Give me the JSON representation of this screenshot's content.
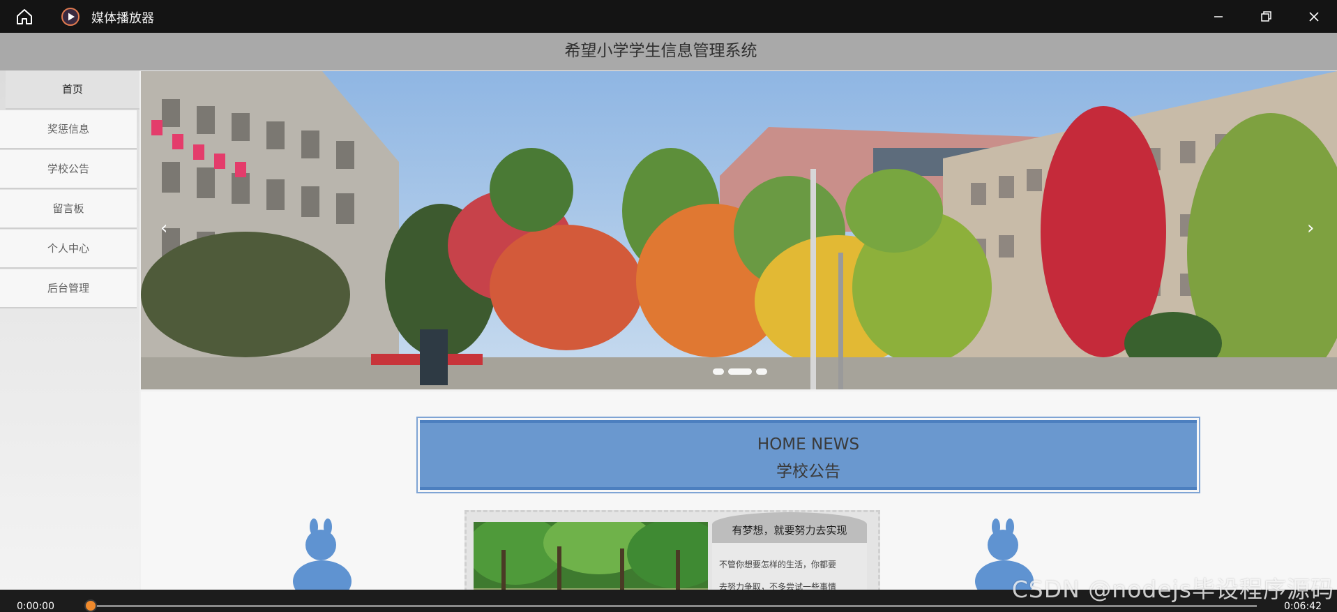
{
  "titlebar": {
    "app_title": "媒体播放器",
    "icons": {
      "home": "home-icon",
      "app": "media-player-play-icon",
      "minimize": "minimize-icon",
      "restore": "restore-icon",
      "close": "close-icon"
    }
  },
  "site": {
    "title": "希望小学学生信息管理系统"
  },
  "sidebar": {
    "items": [
      {
        "label": "首页",
        "active": true
      },
      {
        "label": "奖惩信息",
        "active": false
      },
      {
        "label": "学校公告",
        "active": false
      },
      {
        "label": "留言板",
        "active": false
      },
      {
        "label": "个人中心",
        "active": false
      },
      {
        "label": "后台管理",
        "active": false
      }
    ]
  },
  "carousel": {
    "prev_icon": "chevron-left-icon",
    "next_icon": "chevron-right-icon",
    "prev_glyph": "‹",
    "next_glyph": "›",
    "slide_count": 3,
    "active_index": 1
  },
  "news": {
    "heading_en": "HOME NEWS",
    "heading_cn": "学校公告",
    "card_title": "有梦想，就要努力去实现",
    "card_lines": [
      "不管你想要怎样的生活，你都要",
      "去努力争取，不多尝试一些事情"
    ]
  },
  "player": {
    "current_time": "0:00:00",
    "total_time": "0:06:42",
    "progress": 0.0
  },
  "watermark": "CSDN @nodejs毕设程序源码",
  "colors": {
    "banner_blue": "#6a98cf",
    "progress_thumb": "#f08a2c",
    "titlebar_bg": "#141414"
  }
}
